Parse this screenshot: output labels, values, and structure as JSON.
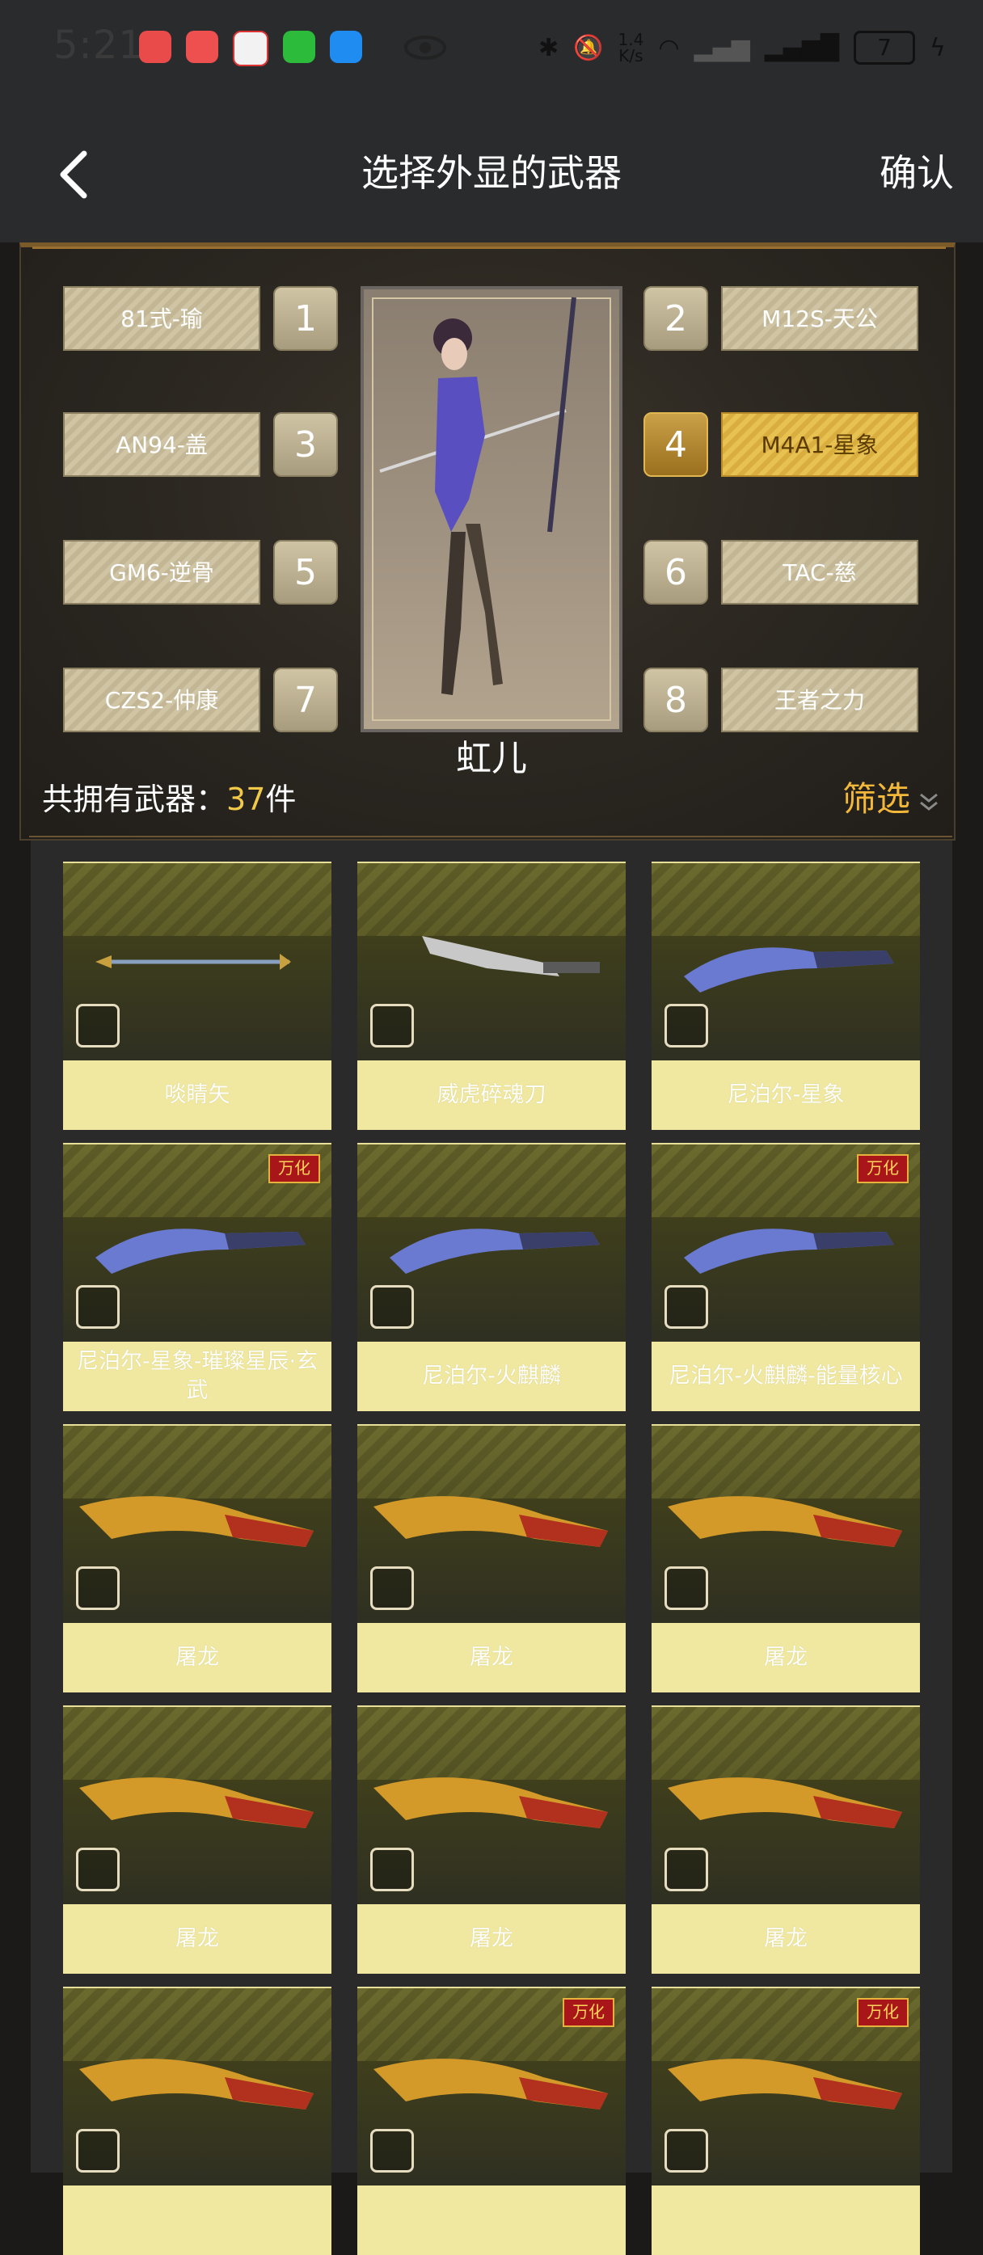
{
  "status_bar": {
    "time": "5:21",
    "net_speed_value": "1.4",
    "net_speed_unit": "K/s",
    "battery": "7"
  },
  "header": {
    "title": "选择外显的武器",
    "confirm_label": "确认"
  },
  "loadout": {
    "character_name": "虹儿",
    "slots": [
      {
        "num": "1",
        "name": "81式-瑜",
        "active": false
      },
      {
        "num": "2",
        "name": "M12S-天公",
        "active": false
      },
      {
        "num": "3",
        "name": "AN94-盖",
        "active": false
      },
      {
        "num": "4",
        "name": "M4A1-星象",
        "active": true
      },
      {
        "num": "5",
        "name": "GM6-逆骨",
        "active": false
      },
      {
        "num": "6",
        "name": "TAC-慈",
        "active": false
      },
      {
        "num": "7",
        "name": "CZS2-仲康",
        "active": false
      },
      {
        "num": "8",
        "name": "王者之力",
        "active": false
      }
    ]
  },
  "summary": {
    "count_label": "共拥有武器：",
    "count_value": "37",
    "count_unit": "件",
    "filter_label": "筛选"
  },
  "weapons": [
    {
      "name": "啖睛矢",
      "badge": "",
      "icon": "arrow-icon"
    },
    {
      "name": "威虎碎魂刀",
      "badge": "",
      "icon": "blade-icon"
    },
    {
      "name": "尼泊尔-星象",
      "badge": "",
      "icon": "kukri-icon"
    },
    {
      "name": "尼泊尔-星象-璀璨星辰·玄武",
      "badge": "万化",
      "icon": "kukri-icon"
    },
    {
      "name": "尼泊尔-火麒麟",
      "badge": "",
      "icon": "kukri-icon"
    },
    {
      "name": "尼泊尔-火麒麟-能量核心",
      "badge": "万化",
      "icon": "kukri-icon"
    },
    {
      "name": "屠龙",
      "badge": "",
      "icon": "dragon-blade-icon"
    },
    {
      "name": "屠龙",
      "badge": "",
      "icon": "dragon-blade-icon"
    },
    {
      "name": "屠龙",
      "badge": "",
      "icon": "dragon-blade-icon"
    },
    {
      "name": "屠龙",
      "badge": "",
      "icon": "dragon-blade-icon"
    },
    {
      "name": "屠龙",
      "badge": "",
      "icon": "dragon-blade-icon"
    },
    {
      "name": "屠龙",
      "badge": "",
      "icon": "dragon-blade-icon"
    },
    {
      "name": "",
      "badge": "",
      "icon": "dragon-blade-icon"
    },
    {
      "name": "",
      "badge": "万化",
      "icon": "dragon-blade-icon"
    },
    {
      "name": "",
      "badge": "万化",
      "icon": "dragon-blade-icon"
    }
  ]
}
